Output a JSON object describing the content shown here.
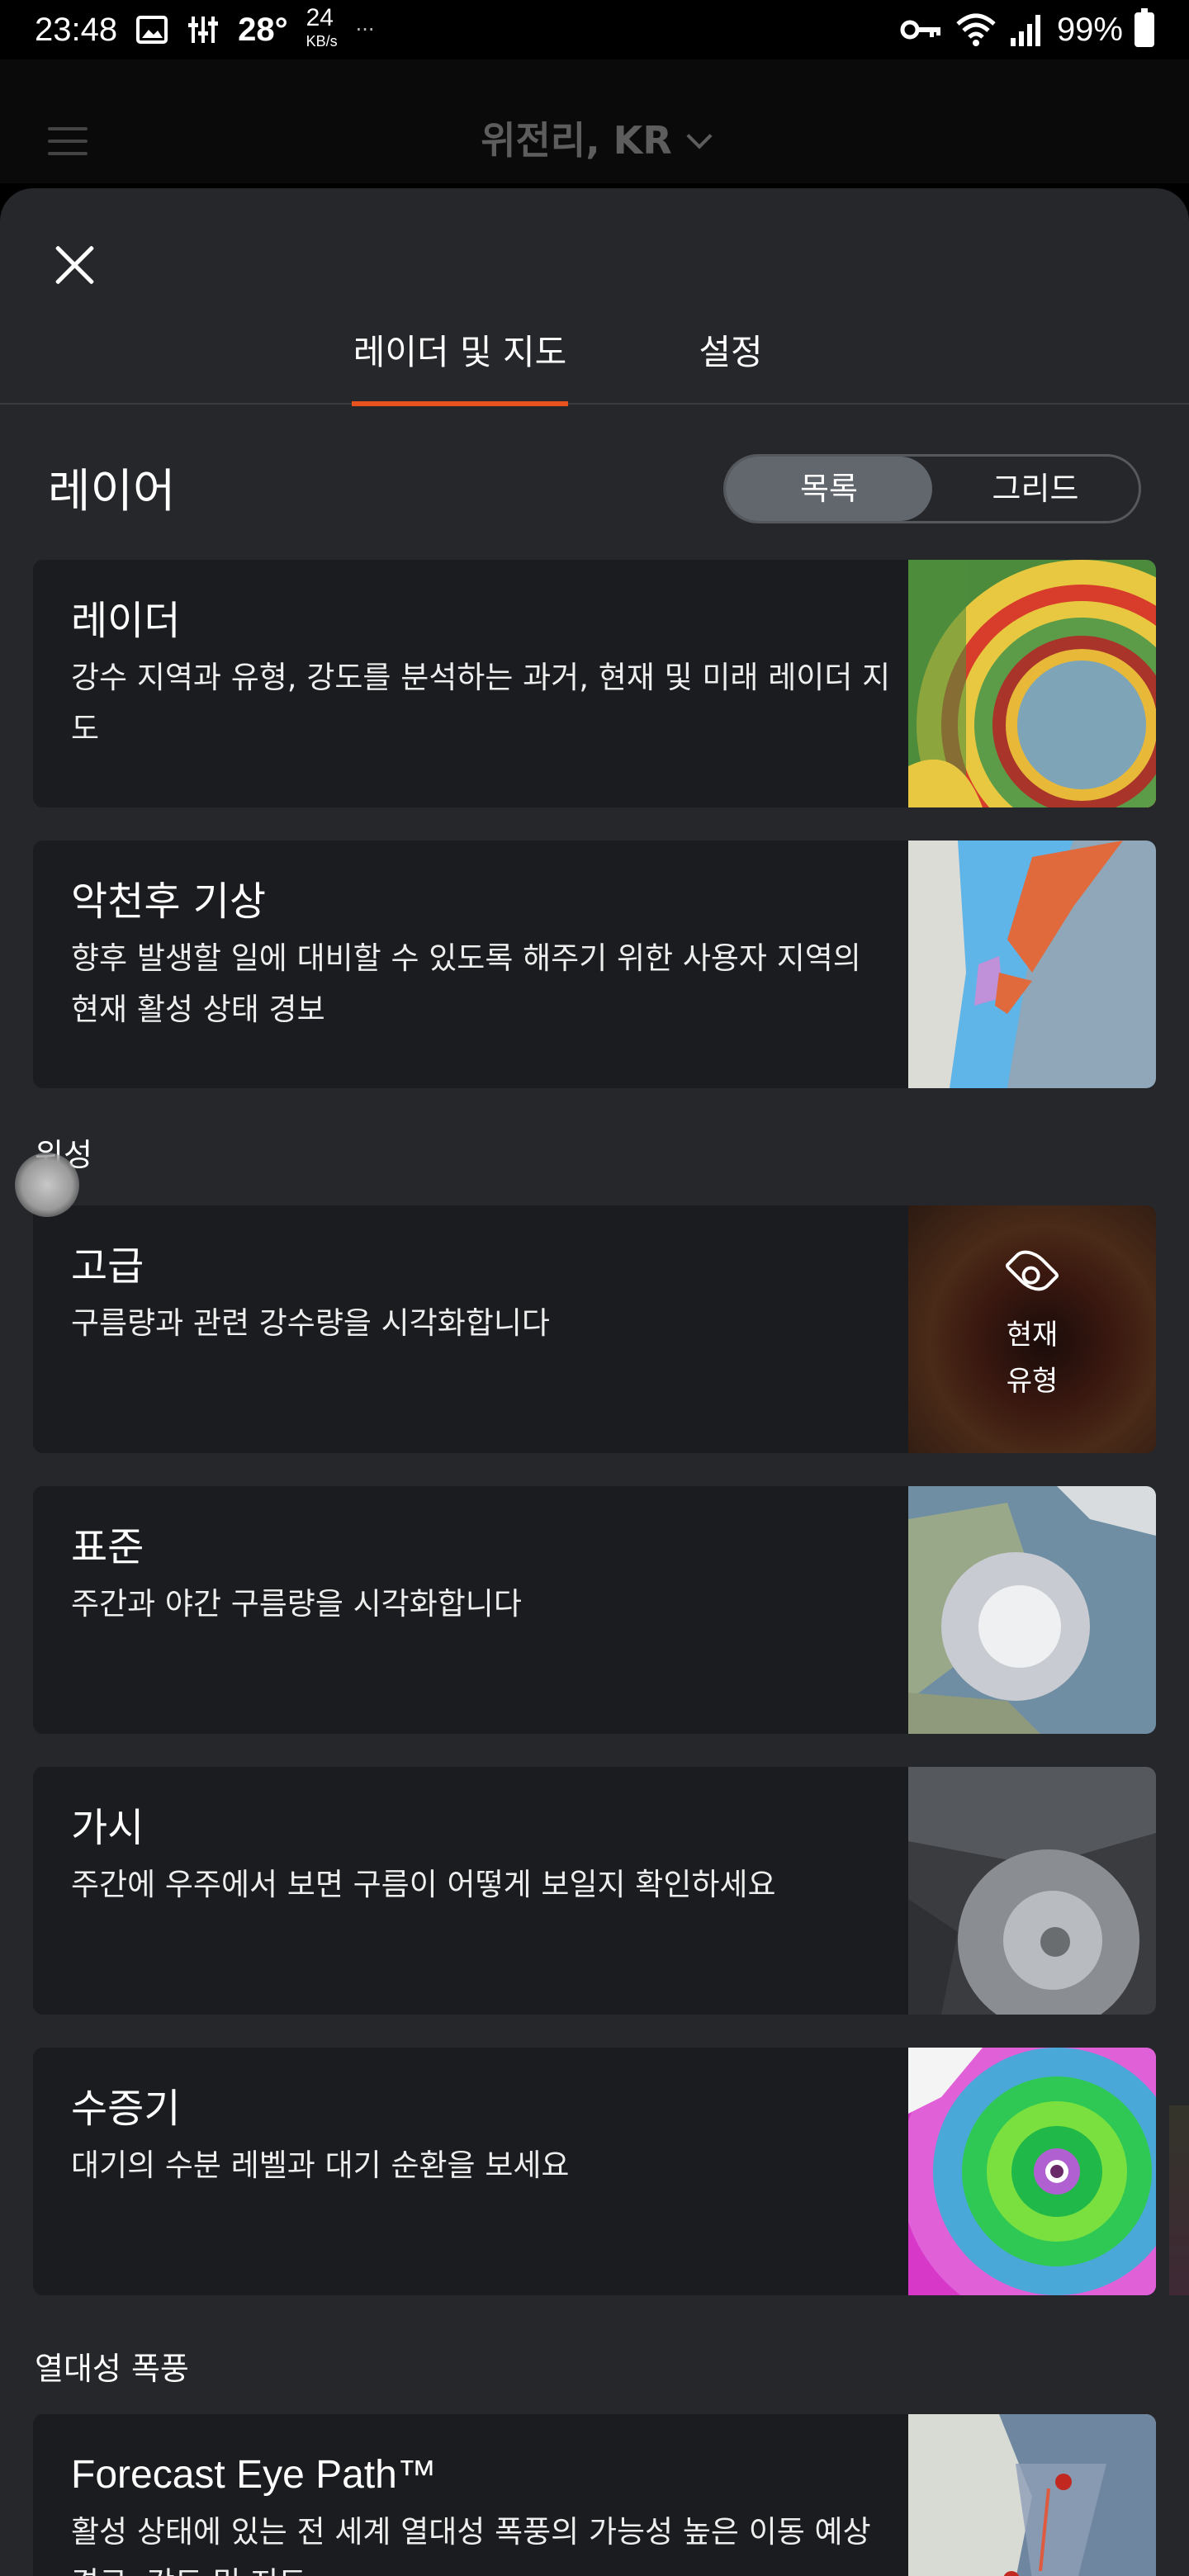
{
  "status": {
    "time": "23:48",
    "temp": "28°",
    "speed_value": "24",
    "speed_unit": "KB/s",
    "dots": "···",
    "battery": "99%"
  },
  "header": {
    "location": "위전리, KR"
  },
  "tabs": {
    "radar_maps": "레이더 및 지도",
    "settings": "설정"
  },
  "layers": {
    "title": "레이어",
    "view_list": "목록",
    "view_grid": "그리드"
  },
  "cards": [
    {
      "title": "레이더",
      "desc": "강수 지역과 유형, 강도를 분석하는 과거, 현재 및 미래 레이더 지도"
    },
    {
      "title": "악천후 기상",
      "desc": "향후 발생할 일에 대비할 수 있도록 해주기 위한 사용자 지역의 현재 활성 상태 경보"
    },
    {
      "title": "고급",
      "desc": "구름량과 관련 강수량을 시각화합니다",
      "badge_line1": "현재",
      "badge_line2": "유형"
    },
    {
      "title": "표준",
      "desc": "주간과 야간 구름량을 시각화합니다"
    },
    {
      "title": "가시",
      "desc": "주간에 우주에서 보면 구름이 어떻게 보일지 확인하세요"
    },
    {
      "title": "수증기",
      "desc": "대기의 수분 레벨과 대기 순환을 보세요"
    },
    {
      "title": "Forecast Eye Path™",
      "desc": "활성 상태에 있는 전 세계 열대성 폭풍의 가능성 높은 이동 예상 경로, 강도 및 지도"
    }
  ],
  "sections": {
    "satellite": "위성",
    "tropical": "열대성 폭풍"
  },
  "colors": {
    "accent": "#e8521e",
    "sheet_bg": "#25272b",
    "card_bg": "#1b1c1f"
  }
}
